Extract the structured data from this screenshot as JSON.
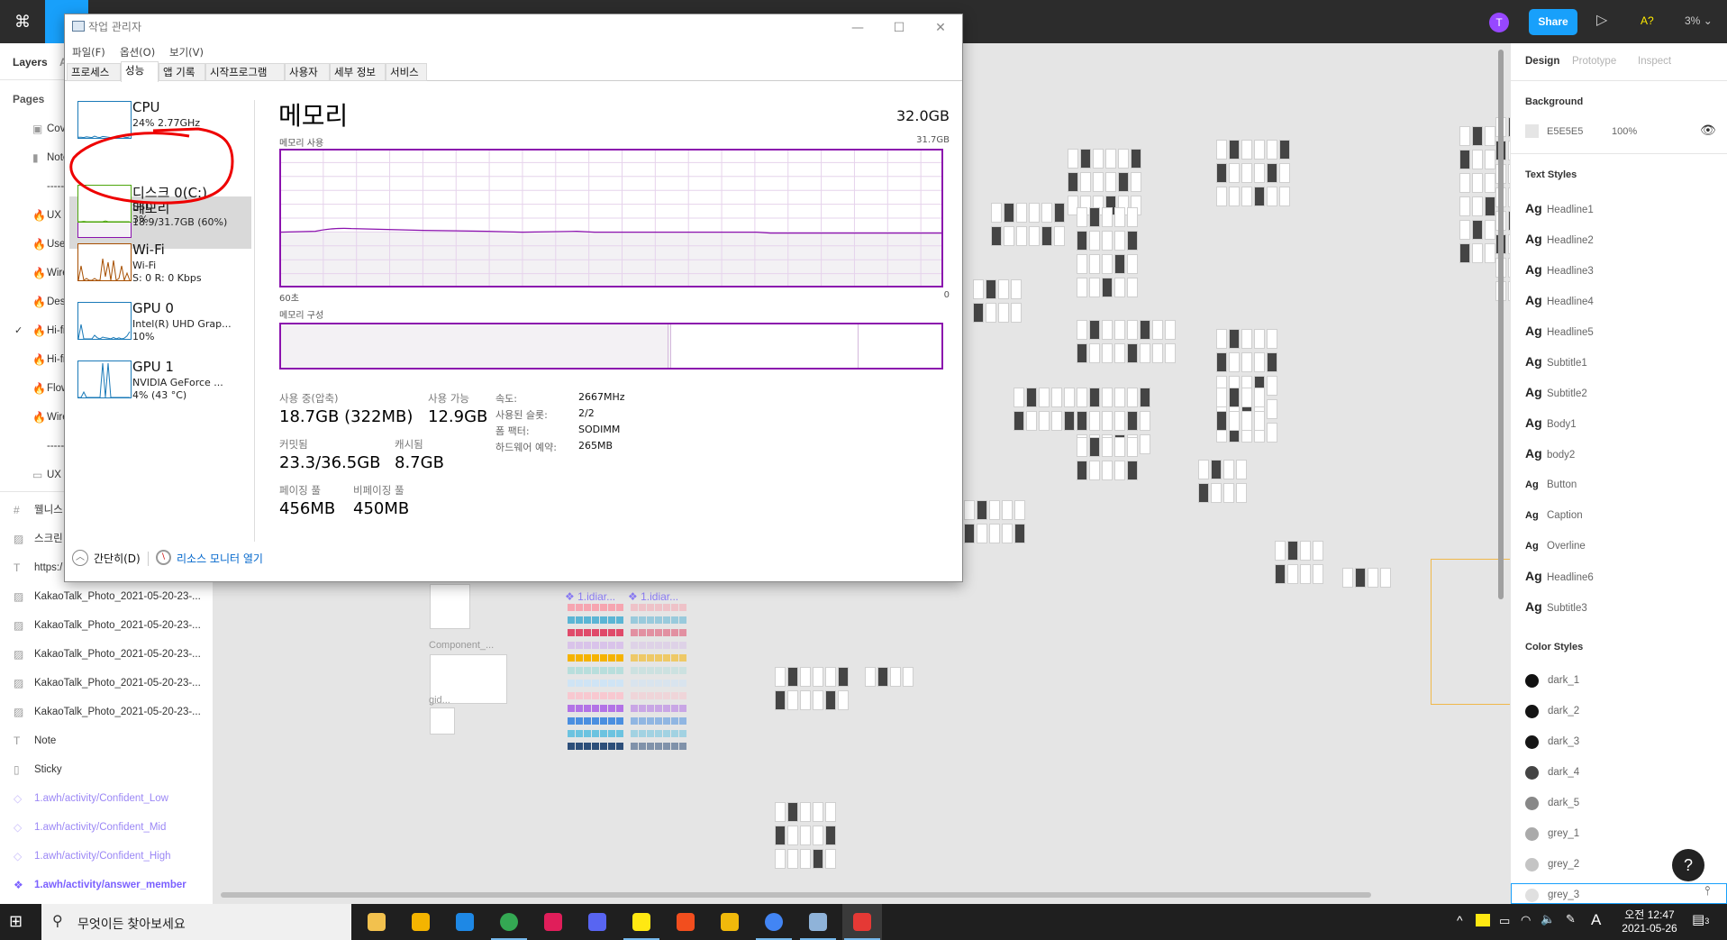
{
  "figma": {
    "topbar": {
      "avatar_initial": "T",
      "share_label": "Share",
      "a11y_label": "A?",
      "zoom": "3%",
      "zoom_arrow": "⌄",
      "play_icon": "▷"
    },
    "sidebar": {
      "tabs": [
        "Layers",
        "A"
      ],
      "pages_label": "Pages",
      "pages": [
        {
          "icon": "▣",
          "name": "Cove"
        },
        {
          "icon": "▮",
          "name": "Note"
        },
        {
          "icon": "",
          "name": "--------"
        },
        {
          "icon": "🔥",
          "name": "UX"
        },
        {
          "icon": "🔥",
          "name": "Use"
        },
        {
          "icon": "🔥",
          "name": "Wire"
        },
        {
          "icon": "🔥",
          "name": "Des"
        },
        {
          "icon": "🔥",
          "name": "Hi-fi",
          "checked": true
        },
        {
          "icon": "🔥",
          "name": "Hi-fi"
        },
        {
          "icon": "🔥",
          "name": "Flow"
        },
        {
          "icon": "🔥",
          "name": "Wire"
        },
        {
          "icon": "",
          "name": "--------"
        },
        {
          "icon": "▭",
          "name": "UX"
        }
      ],
      "layers": [
        {
          "type": "frame",
          "icon": "#",
          "name": "웰니스"
        },
        {
          "type": "image",
          "icon": "▨",
          "name": "스크린"
        },
        {
          "type": "text",
          "icon": "T",
          "name": "https:/"
        },
        {
          "type": "image",
          "icon": "▨",
          "name": "KakaoTalk_Photo_2021-05-20-23-..."
        },
        {
          "type": "image",
          "icon": "▨",
          "name": "KakaoTalk_Photo_2021-05-20-23-..."
        },
        {
          "type": "image",
          "icon": "▨",
          "name": "KakaoTalk_Photo_2021-05-20-23-..."
        },
        {
          "type": "image",
          "icon": "▨",
          "name": "KakaoTalk_Photo_2021-05-20-23-..."
        },
        {
          "type": "image",
          "icon": "▨",
          "name": "KakaoTalk_Photo_2021-05-20-23-..."
        },
        {
          "type": "text",
          "icon": "T",
          "name": "Note"
        },
        {
          "type": "rect",
          "icon": "▯",
          "name": "Sticky"
        },
        {
          "type": "instance",
          "icon": "◇",
          "name": "1.awh/activity/Confident_Low"
        },
        {
          "type": "instance",
          "icon": "◇",
          "name": "1.awh/activity/Confident_Mid"
        },
        {
          "type": "instance",
          "icon": "◇",
          "name": "1.awh/activity/Confident_High"
        },
        {
          "type": "component",
          "icon": "❖",
          "name": "1.awh/activity/answer_member",
          "selected": true
        }
      ]
    },
    "canvas": {
      "labels": [
        "❖ 1.idiar...",
        "❖ 1.idiar...",
        "Component_...",
        "gid..."
      ]
    },
    "right": {
      "tabs": [
        "Design",
        "Prototype",
        "Inspect"
      ],
      "background": {
        "label": "Background",
        "hex": "E5E5E5",
        "opacity": "100%",
        "color": "#e5e5e5"
      },
      "text_styles_label": "Text Styles",
      "text_styles": [
        {
          "ag": "Ag",
          "name": "Headline1"
        },
        {
          "ag": "Ag",
          "name": "Headline2"
        },
        {
          "ag": "Ag",
          "name": "Headline3"
        },
        {
          "ag": "Ag",
          "name": "Headline4"
        },
        {
          "ag": "Ag",
          "name": "Headline5"
        },
        {
          "ag": "Ag",
          "name": "Subtitle1"
        },
        {
          "ag": "Ag",
          "name": "Subtitle2"
        },
        {
          "ag": "Ag",
          "name": "Body1"
        },
        {
          "ag": "Ag",
          "name": "body2"
        },
        {
          "ag": "Ag",
          "name": "Button"
        },
        {
          "ag": "Ag",
          "name": "Caption"
        },
        {
          "ag": "Ag",
          "name": "Overline"
        },
        {
          "ag": "Ag",
          "name": "Headline6"
        },
        {
          "ag": "Ag",
          "name": "Subtitle3"
        }
      ],
      "color_styles_label": "Color Styles",
      "color_styles": [
        {
          "name": "dark_1",
          "color": "#111111"
        },
        {
          "name": "dark_2",
          "color": "#141414"
        },
        {
          "name": "dark_3",
          "color": "#161616"
        },
        {
          "name": "dark_4",
          "color": "#444444"
        },
        {
          "name": "dark_5",
          "color": "#888888"
        },
        {
          "name": "grey_1",
          "color": "#aaaaaa"
        },
        {
          "name": "grey_2",
          "color": "#c4c4c4"
        },
        {
          "name": "grey_3",
          "color": "#e0e0e0"
        }
      ],
      "help_label": "?"
    }
  },
  "taskmgr": {
    "title": "작업 관리자",
    "menu": [
      "파일(F)",
      "옵션(O)",
      "보기(V)"
    ],
    "tabs": [
      "프로세스",
      "성능",
      "앱 기록",
      "시작프로그램",
      "사용자",
      "세부 정보",
      "서비스"
    ],
    "active_tab": "성능",
    "devices": [
      {
        "name": "CPU",
        "line1": "24% 2.77GHz",
        "line2": "",
        "color": "#1a7ab8"
      },
      {
        "name": "메모리",
        "line1": "18.9/31.7GB (60%)",
        "line2": "",
        "color": "#8b12ae",
        "selected": true
      },
      {
        "name": "디스크 0(C:)",
        "line1": "SSD",
        "line2": "3%",
        "color": "#4da60c"
      },
      {
        "name": "Wi-Fi",
        "line1": "Wi-Fi",
        "line2": "S: 0 R: 0 Kbps",
        "color": "#a74f01"
      },
      {
        "name": "GPU 0",
        "line1": "Intel(R) UHD Grap...",
        "line2": "10%",
        "color": "#1a7ab8"
      },
      {
        "name": "GPU 1",
        "line1": "NVIDIA GeForce ...",
        "line2": "4% (43 °C)",
        "color": "#1a7ab8"
      }
    ],
    "memory": {
      "title": "메모리",
      "total": "32.0GB",
      "usage_label": "메모리 사용",
      "usage_max": "31.7GB",
      "time_left": "60초",
      "time_right": "0",
      "composition_label": "메모리 구성",
      "in_use_label": "사용 중(압축)",
      "in_use": "18.7GB (322MB)",
      "available_label": "사용 가능",
      "available": "12.9GB",
      "committed_label": "커밋됨",
      "committed": "23.3/36.5GB",
      "cached_label": "캐시됨",
      "cached": "8.7GB",
      "paged_label": "페이징 풀",
      "paged": "456MB",
      "nonpaged_label": "비페이징 풀",
      "nonpaged": "450MB",
      "specs": [
        {
          "k": "속도:",
          "v": "2667MHz"
        },
        {
          "k": "사용된 슬롯:",
          "v": "2/2"
        },
        {
          "k": "폼 팩터:",
          "v": "SODIMM"
        },
        {
          "k": "하드웨어 예약:",
          "v": "265MB"
        }
      ],
      "usage_percent": 60
    },
    "footer": {
      "collapse": "간단히(D)",
      "resmon": "리소스 모니터 열기"
    }
  },
  "taskbar": {
    "search_placeholder": "무엇이든 찾아보세요",
    "apps": [
      {
        "name": "onedrive-folder",
        "color": "#f2c14e"
      },
      {
        "name": "file-explorer",
        "color": "#f4b400"
      },
      {
        "name": "internet-explorer",
        "color": "#1e88e5"
      },
      {
        "name": "chrome",
        "color": "#34a853"
      },
      {
        "name": "slack",
        "color": "#e01e5a"
      },
      {
        "name": "discord",
        "color": "#5865f2"
      },
      {
        "name": "kakaotalk",
        "color": "#ffe812"
      },
      {
        "name": "figma",
        "color": "#f24e1e"
      },
      {
        "name": "binance",
        "color": "#f0b90b"
      },
      {
        "name": "chrome-profile",
        "color": "#4285f4"
      },
      {
        "name": "task-manager",
        "color": "#8fb3d9"
      },
      {
        "name": "snipping-tool",
        "color": "#e53935"
      }
    ],
    "tray": {
      "ampm": "오전",
      "time": "12:47",
      "date": "2021-05-26",
      "ime": "A",
      "notifications": "3"
    }
  }
}
